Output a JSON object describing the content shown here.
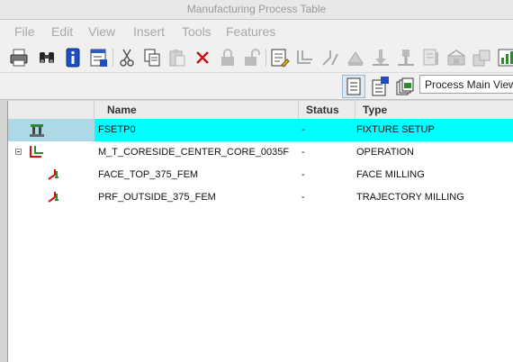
{
  "window": {
    "title": "Manufacturing Process Table"
  },
  "menu": [
    "File",
    "Edit",
    "View",
    "Insert",
    "Tools",
    "Features"
  ],
  "view_selector": {
    "value": "Process Main View"
  },
  "columns": {
    "name": "Name",
    "status": "Status",
    "type": "Type"
  },
  "rows": [
    {
      "name": "FSETP0",
      "status": "-",
      "type": "FIXTURE SETUP"
    },
    {
      "name": "M_T_CORESIDE_CENTER_CORE_0035F",
      "status": "-",
      "type": "OPERATION"
    },
    {
      "name": "FACE_TOP_375_FEM",
      "status": "-",
      "type": "FACE MILLING"
    },
    {
      "name": "PRF_OUTSIDE_375_FEM",
      "status": "-",
      "type": "TRAJECTORY MILLING"
    }
  ],
  "colors": {
    "selected_row": "#00ffff",
    "selected_tree_cell": "#add8e6",
    "accent_red": "#cc1111",
    "accent_green": "#2e8b2e"
  }
}
